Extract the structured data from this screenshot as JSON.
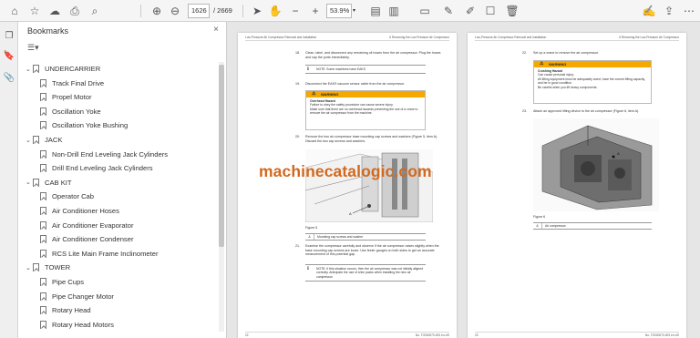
{
  "toolbar": {
    "current_page": "1626",
    "total_pages": "/ 2669",
    "zoom": "53.9%",
    "left_icons": [
      "home-icon",
      "star-icon",
      "cloud-upload-icon",
      "print-icon",
      "search-icon"
    ],
    "nav_icons": [
      "arrow-up-icon",
      "arrow-down-icon"
    ],
    "tool_icons": [
      "pointer-icon",
      "hand-icon",
      "zoom-out-icon",
      "zoom-in-icon"
    ],
    "right_icons": [
      "fit-page-icon",
      "scroll-mode-icon",
      "comment-icon",
      "highlight-icon",
      "draw-icon",
      "erase-icon"
    ],
    "far_right_icons": [
      "sign-icon",
      "share-icon",
      "more-icon"
    ]
  },
  "rail": {
    "icons": [
      "pages-icon",
      "bookmark-icon",
      "attachment-icon"
    ]
  },
  "bookmarks": {
    "title": "Bookmarks",
    "close_glyph": "×",
    "options_glyph": "☰▾",
    "items": [
      {
        "label": "UNDERCARRIER",
        "level": 0,
        "expanded": true
      },
      {
        "label": "Track Final Drive",
        "level": 1
      },
      {
        "label": "Propel Motor",
        "level": 1
      },
      {
        "label": "Oscillation Yoke",
        "level": 1
      },
      {
        "label": "Oscillation Yoke Bushing",
        "level": 1
      },
      {
        "label": "JACK",
        "level": 0,
        "expanded": true
      },
      {
        "label": "Non-Drill End Leveling Jack Cylinders",
        "level": 1
      },
      {
        "label": "Drill End Leveling Jack Cylinders",
        "level": 1
      },
      {
        "label": "CAB KIT",
        "level": 0,
        "expanded": true
      },
      {
        "label": "Operator Cab",
        "level": 1
      },
      {
        "label": "Air Conditioner Hoses",
        "level": 1
      },
      {
        "label": "Air Conditioner Evaporator",
        "level": 1
      },
      {
        "label": "Air Conditioner Condenser",
        "level": 1
      },
      {
        "label": "RCS Lite Main Frame Inclinometer",
        "level": 1
      },
      {
        "label": "TOWER",
        "level": 0,
        "expanded": true
      },
      {
        "label": "Pipe Cups",
        "level": 1
      },
      {
        "label": "Pipe Changer Motor",
        "level": 1
      },
      {
        "label": "Rotary Head",
        "level": 1
      },
      {
        "label": "Rotary Head Motors",
        "level": 1
      }
    ]
  },
  "pages": {
    "left": {
      "header_left": "Low-Pressure Air Compressor Removal and Installation",
      "header_right": "6 Removing the Low-Pressure Air Compressor",
      "step18_num": "18.",
      "step18": "Clean, label, and disconnect any remaining oil hoses from the air compressor. Plug the hoses and cap the ports immediately.",
      "note1": "NOTE: Some machines have EAKS",
      "step19_num": "19.",
      "step19": "Disconnect the EAKS vacuum sensor cable from the air compressor.",
      "warning_title": "WARNING",
      "warning_head": "Overhead Hazard",
      "warning_body1": "Failure to obey the safety procedure can cause severe injury.",
      "warning_body2": "Make sure that there are no overhead hazards preventing the use of a crane to remove the air compressor from the machine.",
      "step20_num": "20.",
      "step20": "Remove the two air compressor base mounting cap screws and washers (Figure 5, item A). Discard the two cap screws and washers.",
      "figure_label": "Figure 5",
      "legend_key": "A",
      "legend_value": "Mounting cap screws and washer",
      "step21_num": "21.",
      "step21": "Examine the compressor carefully and observe if the air compressor raises slightly when the base mounting cap screws are loose. Use feeler gauges on both sides to get an accurate measurement of this potential gap.",
      "note2": "NOTE: If this situation occurs, then the air compressor was not initially aligned correctly. Anticipate the use of shim packs when installing the new air compressor.",
      "footer_page": "22",
      "footer_doc": "No. TO000070-003 en-US"
    },
    "right": {
      "header_left": "Low-Pressure Air Compressor Removal and Installation",
      "header_right": "6 Removing the Low-Pressure Air Compressor",
      "step22_num": "22.",
      "step22": "Set up a crane to remove the air compressor.",
      "warning_title": "WARNING",
      "warning_head": "Crushing Hazard",
      "warning_body1": "Can cause personal injury.",
      "warning_body2": "All lifting equipment must be adequately sized, have the correct lifting capacity, and be in good condition.",
      "warning_body3": "Be careful when you lift heavy components.",
      "step23_num": "23.",
      "step23": "Attach an approved lifting device to the air compressor (Figure 6, item A).",
      "figure_label": "Figure 6",
      "legend_key": "A",
      "legend_value": "Air compressor",
      "footer_page": "23",
      "footer_doc": "No. TO000070-003 en-US"
    }
  },
  "watermark": "machinecatalogic.com",
  "colors": {
    "warning": "#f5a800",
    "watermark": "#d2691e",
    "accent": "#1473e6"
  }
}
